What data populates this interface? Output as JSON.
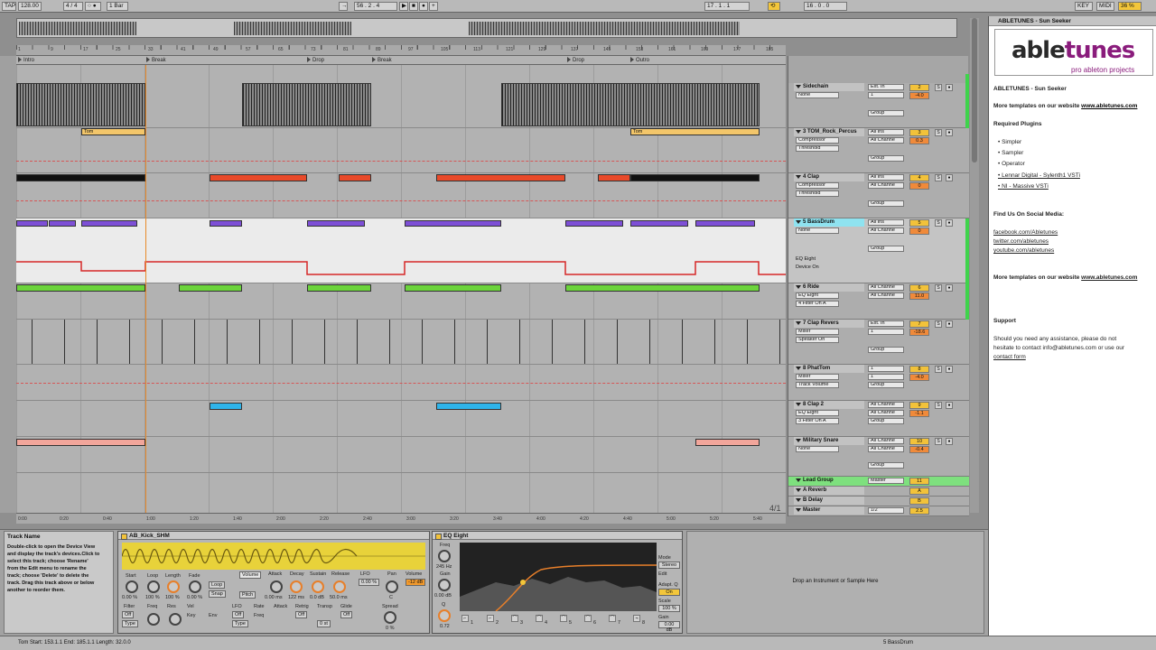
{
  "toolbar": {
    "tap": "TAP",
    "tempo": "128.00",
    "meter": "4 / 4",
    "metronome": "○ ●",
    "quantize": "1 Bar",
    "position": "56 .  2 .  4",
    "loop_start": "17 .  1 .  1",
    "loop_length": "16 .  0 .  0",
    "key": "KEY",
    "midi": "MIDI",
    "cpu": "36 %"
  },
  "locators": [
    "Intro",
    "Break",
    "Drop",
    "Break",
    "Drop",
    "Outro"
  ],
  "ruler_ticks": [
    "1",
    "9",
    "17",
    "25",
    "33",
    "41",
    "49",
    "57",
    "65",
    "73",
    "81",
    "89",
    "97",
    "105",
    "113",
    "121",
    "129",
    "137",
    "145",
    "153",
    "161",
    "169",
    "177",
    "185"
  ],
  "timeline_ticks": [
    "0:00",
    "0:20",
    "0:40",
    "1:00",
    "1:20",
    "1:40",
    "2:00",
    "2:20",
    "2:40",
    "3:00",
    "3:20",
    "3:40",
    "4:00",
    "4:20",
    "4:40",
    "5:00",
    "5:20",
    "5:40"
  ],
  "zoom": "4/1",
  "clips": {
    "tom_a": "Tom",
    "tom_b": "Tom"
  },
  "tracks": [
    {
      "name": "Sidechain",
      "num": "2",
      "in": "Ext. In",
      "route": "1",
      "device": "None",
      "param": "",
      "vol": "-4.0",
      "group": "Group"
    },
    {
      "name": "3 TOM_Rock_Percus",
      "num": "3",
      "in": "All Ins",
      "route": "All Channe",
      "device": "Compressor",
      "param": "Threshold",
      "vol": "0.3",
      "group": "Group"
    },
    {
      "name": "4 Clap",
      "num": "4",
      "in": "All Ins",
      "route": "All Channe",
      "device": "Compressor",
      "param": "Threshold",
      "vol": "0",
      "group": "Group"
    },
    {
      "name": "5 BassDrum",
      "num": "5",
      "in": "All Ins",
      "route": "All Channe",
      "device": "None",
      "param": "",
      "vol": "0",
      "group": "Group"
    },
    {
      "name": "6 Ride",
      "num": "6",
      "in": "All Channe",
      "route": "All Channe",
      "device": "EQ Eight",
      "param": "4 Filter On A",
      "vol": "11.0",
      "group": "Group"
    },
    {
      "name": "7 Clap Revers",
      "num": "7",
      "in": "Ext. In",
      "route": "1",
      "device": "Mixer",
      "param": "Speaker On",
      "vol": "-18.6",
      "group": "Group"
    },
    {
      "name": "8 PhatTom",
      "num": "8",
      "in": "1",
      "route": "1",
      "device": "Mixer",
      "param": "Track Volume",
      "vol": "-4.0",
      "group": "Group"
    },
    {
      "name": "8 Clap 2",
      "num": "9",
      "in": "All Channe",
      "route": "All Channe",
      "device": "EQ Eight",
      "param": "3 Filter On A",
      "vol": "-1.1",
      "group": "Group"
    },
    {
      "name": "Military Snare",
      "num": "10",
      "in": "All Channe",
      "route": "All Channe",
      "device": "None",
      "param": "",
      "vol": "-0.4",
      "group": "Group"
    }
  ],
  "bassdrum_extra": [
    "EQ Eight",
    "Device On"
  ],
  "returns": [
    {
      "name": "Lead Group",
      "route": "Master",
      "num": "11"
    },
    {
      "name": "A Reverb",
      "route": "",
      "num": "A"
    },
    {
      "name": "B Delay",
      "route": "",
      "num": "B"
    },
    {
      "name": "Master",
      "route": "1/2",
      "num": "2.5"
    }
  ],
  "right_panel": {
    "title": "ABLETUNES - Sun Seeker",
    "logo_a": "able",
    "logo_b": "tunes",
    "logo_sub": "pro ableton projects",
    "heading": "ABLETUNES - Sun Seeker",
    "more1_a": "More templates on our website ",
    "more1_link": "www.abletunes.com",
    "req": "Required Plugins",
    "plugins": [
      "Simpler",
      "Sampler",
      "Operator",
      "Lennar Digital - Sylenth1 VSTi",
      "NI - Massive VSTi"
    ],
    "social": "Find Us On Social Media:",
    "links": [
      "facebook.com/Abletunes",
      "twitter.com/abletunes",
      "youtube.com/abletunes"
    ],
    "more2_a": "More templates on our website ",
    "more2_link": "www.abletunes.com",
    "support": "Support",
    "support_text": [
      "Should you need any assistance, please do not",
      "hesitate to contact info@abletunes.com or use our"
    ],
    "contact": "contact form"
  },
  "info": {
    "title": "Track Name",
    "lines": [
      "Double-click to open the Device View",
      "and display the track's devices.Click to",
      "select this track; choose 'Rename'",
      "from the Edit menu to rename the",
      "track; choose 'Delete' to delete the",
      "track. Drag this track above or below",
      "another to reorder them."
    ]
  },
  "simpler": {
    "title": "AB_Kick_SHM",
    "labels": [
      "Start",
      "Loop",
      "Length",
      "Fade",
      "Loop",
      "Volume",
      "Attack",
      "Decay",
      "Sustain",
      "Release",
      "LFO",
      "Pan",
      "Volume"
    ],
    "values": [
      "0.00 %",
      "100 %",
      "100 %",
      "0.00 %",
      "Snap",
      "0.00 ms",
      "122 ms",
      "0.0 dB",
      "50.0 ms",
      "0.00 %",
      "C",
      "-12 dB"
    ],
    "lower_labels": [
      "Filter",
      "Freq",
      "Res",
      "Vel",
      "LFO",
      "Rate",
      "Attack",
      "Retrig",
      "Transp",
      "Glide",
      "Spread"
    ],
    "lower_values": [
      "Off",
      "Type",
      "Key",
      "Env",
      "Off",
      "Type",
      "Freq",
      "Off",
      "0 st",
      "Off",
      "0 %"
    ],
    "pitch": "Pitch"
  },
  "eq": {
    "title": "EQ Eight",
    "freq_label": "Freq",
    "freq": "245 Hz",
    "gain_label": "Gain",
    "gain": "0.00 dB",
    "q_label": "Q",
    "q": "0.72",
    "mode": "Mode",
    "stereo": "Stereo",
    "edit": "Edit",
    "adapt": "Adapt. Q",
    "adapt_val": "On",
    "scale": "Scale",
    "scale_val": "100 %",
    "gain2": "Gain",
    "gain2_val": "0.00 dB",
    "bands": [
      "1",
      "2",
      "3",
      "4",
      "5",
      "6",
      "7",
      "8"
    ]
  },
  "drop_zone": "Drop an Instrument or Sample Here",
  "status": {
    "left": "Tom  Start: 153.1.1  End: 185.1.1  Length: 32.0.0",
    "right": "5 BassDrum"
  }
}
